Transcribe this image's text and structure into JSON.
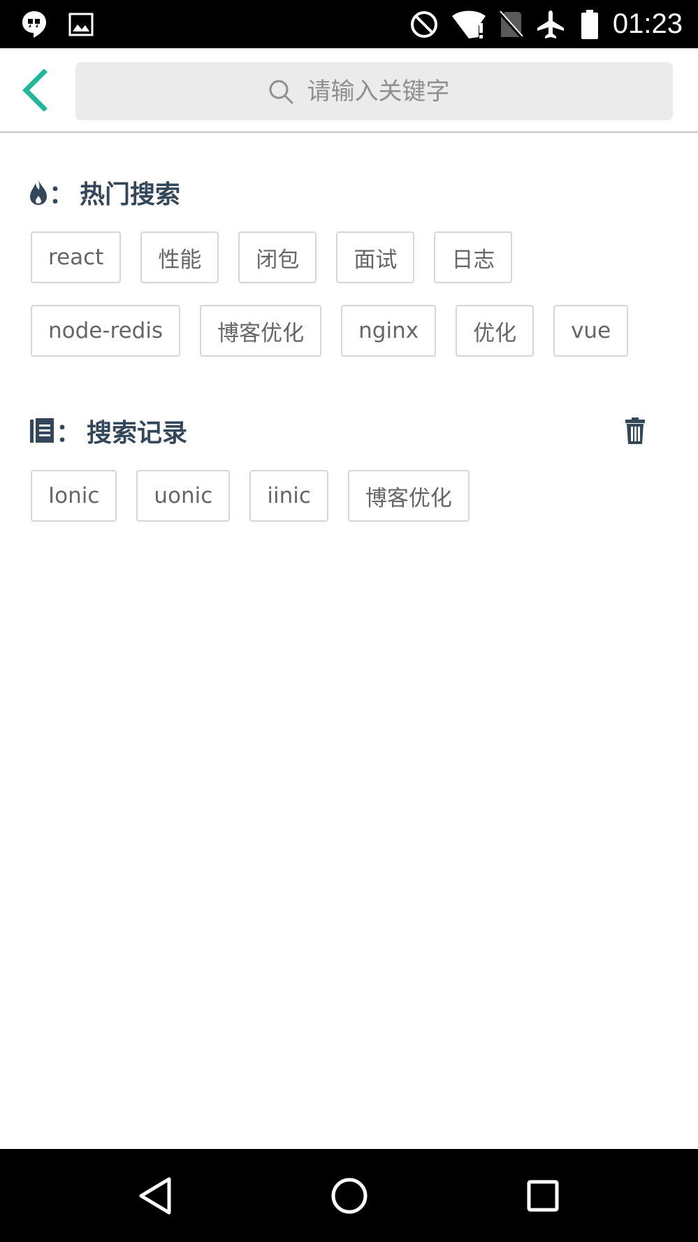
{
  "status_bar": {
    "time": "01:23",
    "left_icons": [
      "hangouts-icon",
      "image-icon"
    ],
    "right_icons": [
      "do-not-disturb-icon",
      "wifi-alert-icon",
      "no-sim-icon",
      "airplane-icon",
      "battery-icon"
    ]
  },
  "header": {
    "back_icon": "chevron-left-icon",
    "search_placeholder": "请输入关键字",
    "search_value": "",
    "accent_color": "#1fb89b"
  },
  "hot_search": {
    "icon": "fire-icon",
    "colon": "：",
    "title": "热门搜索",
    "rows": [
      [
        "react",
        "性能",
        "闭包",
        "面试",
        "日志"
      ],
      [
        "node-redis",
        "博客优化",
        "nginx",
        "优化",
        "vue"
      ]
    ]
  },
  "history": {
    "icon": "list-icon",
    "colon": "：",
    "title": "搜索记录",
    "clear_icon": "trash-icon",
    "items": [
      "Ionic",
      "uonic",
      "iinic",
      "博客优化"
    ]
  },
  "nav_bar": {
    "buttons": [
      "back-triangle-icon",
      "home-circle-icon",
      "recents-square-icon"
    ]
  },
  "colors": {
    "title_text": "#33475b",
    "tag_text": "#666666",
    "tag_border": "#d6d6d6"
  }
}
